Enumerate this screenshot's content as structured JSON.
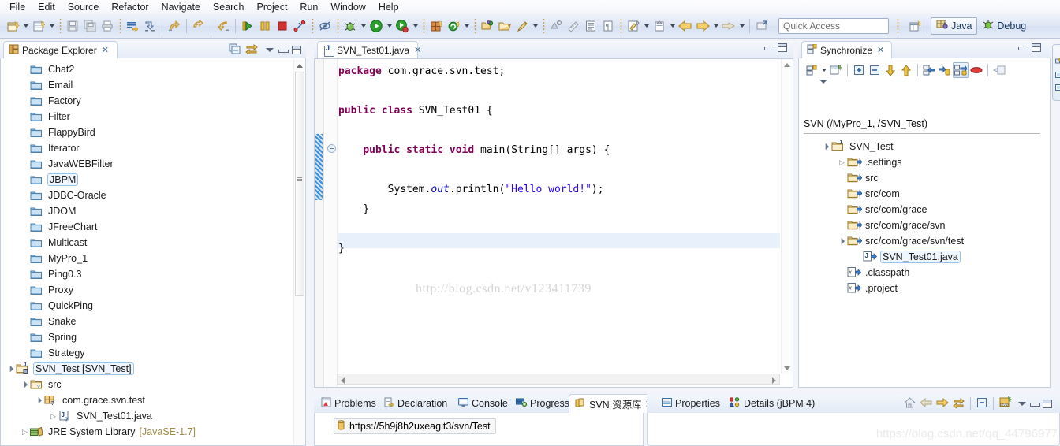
{
  "menu": {
    "items": [
      "File",
      "Edit",
      "Source",
      "Refactor",
      "Navigate",
      "Search",
      "Project",
      "Run",
      "Window",
      "Help"
    ]
  },
  "toolbar": {
    "icons": [
      "new-java-project-icon",
      "new-wizard-dropdown-icon",
      "new-item-icon",
      "new-item-dropdown-icon",
      "save-icon",
      "save-all-icon",
      "print-icon",
      "toggle-mark-occurrences-icon",
      "skip-all-breakpoints-icon",
      "back-to-icon",
      "forward-icon",
      "next-annotation-icon",
      "run-icon",
      "suspend-icon",
      "terminate-icon",
      "disconnect-icon",
      "no-debug-icon",
      "debug-icon",
      "debug-dropdown-icon",
      "run-green-icon",
      "run-dropdown-icon",
      "run-coverage-icon",
      "coverage-dropdown-icon",
      "new-package-icon",
      "new-class-icon",
      "new-class-dropdown-icon",
      "open-type-icon",
      "open-task-icon",
      "search-icon",
      "search-dropdown-icon",
      "annotation-icon",
      "ruler-icon",
      "show-whitespace-icon",
      "pilcrow-icon",
      "last-edit-location-icon",
      "last-edit-dropdown-icon",
      "next-edit-icon",
      "next-edit-dropdown-icon",
      "back-nav-icon",
      "back-nav-dropdown-icon",
      "forward-nav-icon",
      "forward-nav-dropdown-icon",
      "external-tools-icon"
    ],
    "quick_access_placeholder": "Quick Access",
    "open-perspective-icon": "open-perspective-icon",
    "perspectives": [
      {
        "label": "Java",
        "icon": "java-perspective-icon",
        "active": true
      },
      {
        "label": "Debug",
        "icon": "debug-perspective-icon",
        "active": false
      }
    ]
  },
  "package_explorer": {
    "tab_label": "Package Explorer",
    "tab_icon": "package-explorer-icon",
    "close_glyph": "✕",
    "toolbar": [
      {
        "name": "collapse-all-icon"
      },
      {
        "name": "link-with-editor-icon"
      },
      {
        "name": "view-menu-icon"
      },
      {
        "name": "minimize-icon"
      },
      {
        "name": "maximize-icon"
      }
    ],
    "tree": [
      {
        "label": "Chat2",
        "icon": "folder-icon",
        "indent": 1,
        "arrow": "none",
        "selected": false
      },
      {
        "label": "Email",
        "icon": "folder-icon",
        "indent": 1,
        "arrow": "none",
        "selected": false
      },
      {
        "label": "Factory",
        "icon": "folder-icon",
        "indent": 1,
        "arrow": "none",
        "selected": false
      },
      {
        "label": "Filter",
        "icon": "folder-icon",
        "indent": 1,
        "arrow": "none",
        "selected": false
      },
      {
        "label": "FlappyBird",
        "icon": "folder-icon",
        "indent": 1,
        "arrow": "none",
        "selected": false
      },
      {
        "label": "Iterator",
        "icon": "folder-icon",
        "indent": 1,
        "arrow": "none",
        "selected": false
      },
      {
        "label": "JavaWEBFilter",
        "icon": "folder-icon",
        "indent": 1,
        "arrow": "none",
        "selected": false
      },
      {
        "label": "JBPM",
        "icon": "folder-icon",
        "indent": 1,
        "arrow": "none",
        "selected": true
      },
      {
        "label": "JDBC-Oracle",
        "icon": "folder-icon",
        "indent": 1,
        "arrow": "none",
        "selected": false
      },
      {
        "label": "JDOM",
        "icon": "folder-icon",
        "indent": 1,
        "arrow": "none",
        "selected": false
      },
      {
        "label": "JFreeChart",
        "icon": "folder-icon",
        "indent": 1,
        "arrow": "none",
        "selected": false
      },
      {
        "label": "Multicast",
        "icon": "folder-icon",
        "indent": 1,
        "arrow": "none",
        "selected": false
      },
      {
        "label": "MyPro_1",
        "icon": "folder-icon",
        "indent": 1,
        "arrow": "none",
        "selected": false
      },
      {
        "label": "Ping0.3",
        "icon": "folder-icon",
        "indent": 1,
        "arrow": "none",
        "selected": false
      },
      {
        "label": "Proxy",
        "icon": "folder-icon",
        "indent": 1,
        "arrow": "none",
        "selected": false
      },
      {
        "label": "QuickPing",
        "icon": "folder-icon",
        "indent": 1,
        "arrow": "none",
        "selected": false
      },
      {
        "label": "Snake",
        "icon": "folder-icon",
        "indent": 1,
        "arrow": "none",
        "selected": false
      },
      {
        "label": "Spring",
        "icon": "folder-icon",
        "indent": 1,
        "arrow": "none",
        "selected": false
      },
      {
        "label": "Strategy",
        "icon": "folder-icon",
        "indent": 1,
        "arrow": "none",
        "selected": false
      },
      {
        "label": "SVN_Test [SVN_Test]",
        "icon": "java-project-icon",
        "indent": 0,
        "arrow": "open",
        "selected": true
      },
      {
        "label": "src",
        "icon": "source-folder-icon",
        "indent": 1,
        "arrow": "open",
        "selected": false
      },
      {
        "label": "com.grace.svn.test",
        "icon": "package-icon",
        "indent": 2,
        "arrow": "open",
        "selected": false
      },
      {
        "label": "SVN_Test01.java",
        "icon": "java-file-icon",
        "indent": 3,
        "arrow": "closed",
        "selected": false
      },
      {
        "label": "JRE System Library",
        "suffix": "[JavaSE-1.7]",
        "icon": "jre-library-icon",
        "indent": 1,
        "arrow": "closed",
        "selected": false
      }
    ]
  },
  "editor": {
    "tab_label": "SVN_Test01.java",
    "tab_icon": "java-file-icon",
    "close_glyph": "✕",
    "minimize_icon": "minimize-icon",
    "maximize_icon": "maximize-icon",
    "code_lines": [
      [
        {
          "t": "package ",
          "c": "kw"
        },
        {
          "t": "com.grace.svn.test;",
          "c": "plain"
        }
      ],
      [
        {
          "t": "",
          "c": "plain"
        }
      ],
      [
        {
          "t": "public class ",
          "c": "kw"
        },
        {
          "t": "SVN_Test01 {",
          "c": "plain"
        }
      ],
      [
        {
          "t": "",
          "c": "plain"
        }
      ],
      [
        {
          "t": "    ",
          "c": "plain"
        },
        {
          "t": "public static void ",
          "c": "kw"
        },
        {
          "t": "main(String[] args) {",
          "c": "plain"
        }
      ],
      [
        {
          "t": "",
          "c": "plain"
        }
      ],
      [
        {
          "t": "        System.",
          "c": "plain"
        },
        {
          "t": "out",
          "c": "fieldi"
        },
        {
          "t": ".println(",
          "c": "plain"
        },
        {
          "t": "\"Hello world!\"",
          "c": "str"
        },
        {
          "t": ");",
          "c": "plain"
        }
      ],
      [
        {
          "t": "    }",
          "c": "plain"
        }
      ],
      [
        {
          "t": "",
          "c": "plain"
        }
      ],
      [
        {
          "t": "}",
          "c": "plain"
        }
      ]
    ],
    "watermark": "http://blog.csdn.net/v123411739"
  },
  "synchronize": {
    "tab_label": "Synchronize",
    "tab_icon": "synchronize-icon",
    "close_glyph": "✕",
    "toolbar": [
      {
        "name": "synchronize-dropdown-icon"
      },
      {
        "name": "open-sync-wizard-icon"
      },
      {
        "name": "expand-all-icon"
      },
      {
        "name": "collapse-all-icon"
      },
      {
        "name": "incoming-mode-icon"
      },
      {
        "name": "outgoing-mode-icon"
      },
      {
        "name": "previous-change-icon"
      },
      {
        "name": "next-change-icon"
      },
      {
        "name": "both-mode-icon"
      },
      {
        "name": "conflicts-mode-icon"
      },
      {
        "name": "pin-sync-icon"
      },
      {
        "name": "view-menu-icon"
      }
    ],
    "root_label": "SVN (/MyPro_1, /SVN_Test)",
    "tree": [
      {
        "label": "SVN_Test",
        "icon": "project-outgoing-icon",
        "indent": 0,
        "arrow": "open",
        "selected": false
      },
      {
        "label": ".settings",
        "icon": "folder-outgoing-icon",
        "indent": 1,
        "arrow": "closed",
        "selected": false
      },
      {
        "label": "src",
        "icon": "folder-outgoing-icon",
        "indent": 1,
        "arrow": "none",
        "selected": false
      },
      {
        "label": "src/com",
        "icon": "folder-outgoing-icon",
        "indent": 1,
        "arrow": "none",
        "selected": false
      },
      {
        "label": "src/com/grace",
        "icon": "folder-outgoing-icon",
        "indent": 1,
        "arrow": "none",
        "selected": false
      },
      {
        "label": "src/com/grace/svn",
        "icon": "folder-outgoing-icon",
        "indent": 1,
        "arrow": "none",
        "selected": false
      },
      {
        "label": "src/com/grace/svn/test",
        "icon": "folder-outgoing-icon",
        "indent": 1,
        "arrow": "open",
        "selected": false
      },
      {
        "label": "SVN_Test01.java",
        "icon": "java-outgoing-icon",
        "indent": 2,
        "arrow": "none",
        "selected": true
      },
      {
        "label": ".classpath",
        "icon": "xml-outgoing-icon",
        "indent": 1,
        "arrow": "none",
        "selected": false
      },
      {
        "label": ".project",
        "icon": "xml-outgoing-icon",
        "indent": 1,
        "arrow": "none",
        "selected": false
      }
    ],
    "minimize_icon": "minimize-icon",
    "maximize_icon": "maximize-icon"
  },
  "bottom_panel": {
    "tabs": [
      {
        "label": "Problems",
        "icon": "problems-icon",
        "active": false,
        "closeable": false
      },
      {
        "label": "Declaration",
        "icon": "declaration-icon",
        "active": false,
        "closeable": false
      },
      {
        "label": "Console",
        "icon": "console-icon",
        "active": false,
        "closeable": false
      },
      {
        "label": "Progress",
        "icon": "progress-icon",
        "active": false,
        "closeable": false
      },
      {
        "label": "SVN 资源库",
        "icon": "svn-repository-icon",
        "active": true,
        "closeable": true
      }
    ],
    "right_tabs": [
      {
        "label": "Properties",
        "icon": "properties-icon",
        "active": false
      },
      {
        "label": "Details (jBPM 4)",
        "icon": "details-icon",
        "active": false
      }
    ],
    "right_toolbar": [
      {
        "name": "home-icon"
      },
      {
        "name": "back-icon"
      },
      {
        "name": "forward-icon"
      },
      {
        "name": "refresh-icon"
      },
      {
        "name": "collapse-all-icon"
      },
      {
        "name": "new-repository-location-icon"
      },
      {
        "name": "view-menu-icon"
      },
      {
        "name": "minimize-icon"
      },
      {
        "name": "maximize-icon"
      }
    ],
    "repository_url": "https://5h9j8h2uxeagit3/svn/Test",
    "repository_icon": "repository-location-icon",
    "watermark": "https://blog.csdn.net/qq_44796977"
  }
}
